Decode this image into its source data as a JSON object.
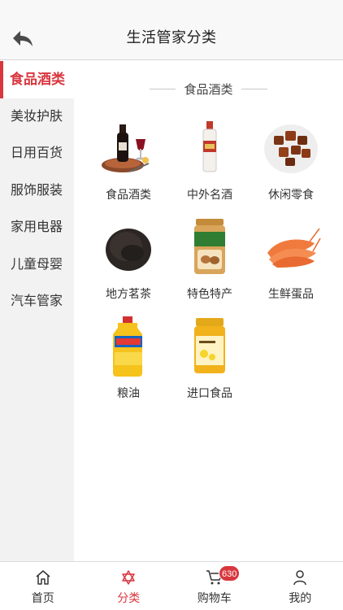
{
  "header": {
    "title": "生活管家分类",
    "back_icon": "back-arrow-icon"
  },
  "sidebar": {
    "items": [
      {
        "label": "食品酒类",
        "active": true
      },
      {
        "label": "美妆护肤",
        "active": false
      },
      {
        "label": "日用百货",
        "active": false
      },
      {
        "label": "服饰服装",
        "active": false
      },
      {
        "label": "家用电器",
        "active": false
      },
      {
        "label": "儿童母婴",
        "active": false
      },
      {
        "label": "汽车管家",
        "active": false
      }
    ]
  },
  "main": {
    "section_title": "食品酒类",
    "categories": [
      {
        "label": "食品酒类",
        "icon": "wine-steak-image"
      },
      {
        "label": "中外名酒",
        "icon": "liquor-bottle-image"
      },
      {
        "label": "休闲零食",
        "icon": "snack-plate-image"
      },
      {
        "label": "地方茗茶",
        "icon": "tea-leaves-image"
      },
      {
        "label": "特色特产",
        "icon": "nut-jar-image"
      },
      {
        "label": "生鲜蛋品",
        "icon": "shrimp-image"
      },
      {
        "label": "粮油",
        "icon": "oil-bottle-image"
      },
      {
        "label": "进口食品",
        "icon": "honey-jar-image"
      }
    ]
  },
  "tabbar": {
    "tabs": [
      {
        "label": "首页",
        "icon": "home-icon",
        "active": false
      },
      {
        "label": "分类",
        "icon": "category-star-icon",
        "active": true
      },
      {
        "label": "购物车",
        "icon": "cart-icon",
        "active": false,
        "badge": "630"
      },
      {
        "label": "我的",
        "icon": "profile-icon",
        "active": false
      }
    ]
  },
  "colors": {
    "accent": "#d9363e",
    "sidebar_bg": "#f2f2f2",
    "navbar_bg": "#f8f8f8"
  }
}
